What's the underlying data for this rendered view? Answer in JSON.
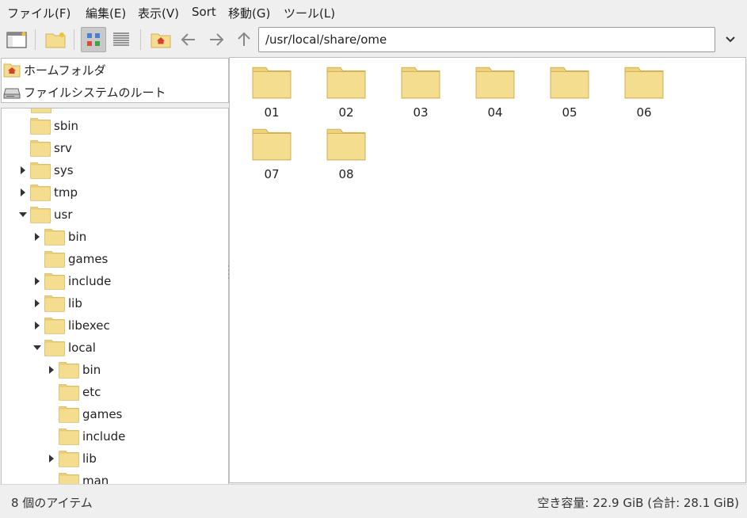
{
  "menu": [
    "ファイル(F)",
    "編集(E)",
    "表示(V)",
    "Sort",
    "移動(G)",
    "ツール(L)"
  ],
  "path": "/usr/local/share/ome",
  "places": [
    {
      "label": "ホームフォルダ",
      "icon": "home-folder-icon"
    },
    {
      "label": "ファイルシステムのルート",
      "icon": "drive-icon"
    }
  ],
  "tree": [
    {
      "label": "sbin",
      "expandable": false,
      "level": 0
    },
    {
      "label": "srv",
      "expandable": false,
      "level": 0
    },
    {
      "label": "sys",
      "expandable": true,
      "expanded": false,
      "level": 0
    },
    {
      "label": "tmp",
      "expandable": true,
      "expanded": false,
      "level": 0
    },
    {
      "label": "usr",
      "expandable": true,
      "expanded": true,
      "level": 0
    },
    {
      "label": "bin",
      "expandable": true,
      "expanded": false,
      "level": 1
    },
    {
      "label": "games",
      "expandable": false,
      "level": 1
    },
    {
      "label": "include",
      "expandable": true,
      "expanded": false,
      "level": 1
    },
    {
      "label": "lib",
      "expandable": true,
      "expanded": false,
      "level": 1
    },
    {
      "label": "libexec",
      "expandable": true,
      "expanded": false,
      "level": 1
    },
    {
      "label": "local",
      "expandable": true,
      "expanded": true,
      "level": 1
    },
    {
      "label": "bin",
      "expandable": true,
      "expanded": false,
      "level": 2
    },
    {
      "label": "etc",
      "expandable": false,
      "level": 2
    },
    {
      "label": "games",
      "expandable": false,
      "level": 2
    },
    {
      "label": "include",
      "expandable": false,
      "level": 2
    },
    {
      "label": "lib",
      "expandable": true,
      "expanded": false,
      "level": 2
    },
    {
      "label": "man",
      "expandable": false,
      "level": 2
    }
  ],
  "files": [
    "01",
    "02",
    "03",
    "04",
    "05",
    "06",
    "07",
    "08"
  ],
  "status": {
    "count": "8 個のアイテム",
    "free_label": "空き容量",
    "free_value": ": 22.9 GiB (合計: 28.1 GiB)"
  },
  "colors": {
    "folder_fill": "#f5dd8f",
    "folder_tab": "#f0d27a",
    "folder_stroke": "#d1b25a",
    "home_accent": "#d6402f"
  }
}
